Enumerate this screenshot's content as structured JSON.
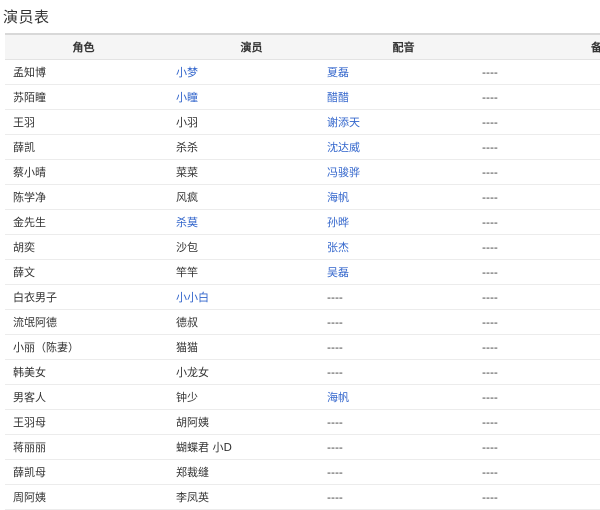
{
  "page": {
    "title": "演员表"
  },
  "table": {
    "headers": {
      "role": "角色",
      "actor": "演员",
      "voice": "配音",
      "note": "备注"
    },
    "rows": [
      {
        "role": "孟知博",
        "actor": "小梦",
        "actor_link": true,
        "voice": "夏磊",
        "voice_link": true,
        "note": "----"
      },
      {
        "role": "苏陌瞳",
        "actor": "小瞳",
        "actor_link": true,
        "voice": "醋醋",
        "voice_link": true,
        "note": "----"
      },
      {
        "role": "王羽",
        "actor": "小羽",
        "actor_link": false,
        "voice": "谢添天",
        "voice_link": true,
        "note": "----"
      },
      {
        "role": "薛凯",
        "actor": "杀杀",
        "actor_link": false,
        "voice": "沈达威",
        "voice_link": true,
        "note": "----"
      },
      {
        "role": "蔡小晴",
        "actor": "菜菜",
        "actor_link": false,
        "voice": "冯骏骅",
        "voice_link": true,
        "note": "----"
      },
      {
        "role": "陈学净",
        "actor": "风疯",
        "actor_link": false,
        "voice": "海帆",
        "voice_link": true,
        "note": "----"
      },
      {
        "role": "金先生",
        "actor": "杀莫",
        "actor_link": true,
        "voice": "孙晔",
        "voice_link": true,
        "note": "----"
      },
      {
        "role": "胡奕",
        "actor": "沙包",
        "actor_link": false,
        "voice": "张杰",
        "voice_link": true,
        "note": "----"
      },
      {
        "role": "薛文",
        "actor": "竿竿",
        "actor_link": false,
        "voice": "吴磊",
        "voice_link": true,
        "note": "----"
      },
      {
        "role": "白衣男子",
        "actor": "小小白",
        "actor_link": true,
        "voice": "----",
        "voice_link": false,
        "note": "----"
      },
      {
        "role": "流氓阿德",
        "actor": "德叔",
        "actor_link": false,
        "voice": "----",
        "voice_link": false,
        "note": "----"
      },
      {
        "role": "小丽（陈妻）",
        "actor": "猫猫",
        "actor_link": false,
        "voice": "----",
        "voice_link": false,
        "note": "----"
      },
      {
        "role": "韩美女",
        "actor": "小龙女",
        "actor_link": false,
        "voice": "----",
        "voice_link": false,
        "note": "----"
      },
      {
        "role": "男客人",
        "actor": "钟少",
        "actor_link": false,
        "voice": "海帆",
        "voice_link": true,
        "note": "----"
      },
      {
        "role": "王羽母",
        "actor": "胡阿姨",
        "actor_link": false,
        "voice": "----",
        "voice_link": false,
        "note": "----"
      },
      {
        "role": "蒋丽丽",
        "actor": "蝴蝶君 小D",
        "actor_link": false,
        "voice": "----",
        "voice_link": false,
        "note": "----"
      },
      {
        "role": "薛凯母",
        "actor": "郑裁缝",
        "actor_link": false,
        "voice": "----",
        "voice_link": false,
        "note": "----"
      },
      {
        "role": "周阿姨",
        "actor": "李凤英",
        "actor_link": false,
        "voice": "----",
        "voice_link": false,
        "note": "----"
      }
    ]
  },
  "colors": {
    "link": "#3366cc",
    "text": "#333333",
    "header_bg": "#f5f5f5"
  }
}
